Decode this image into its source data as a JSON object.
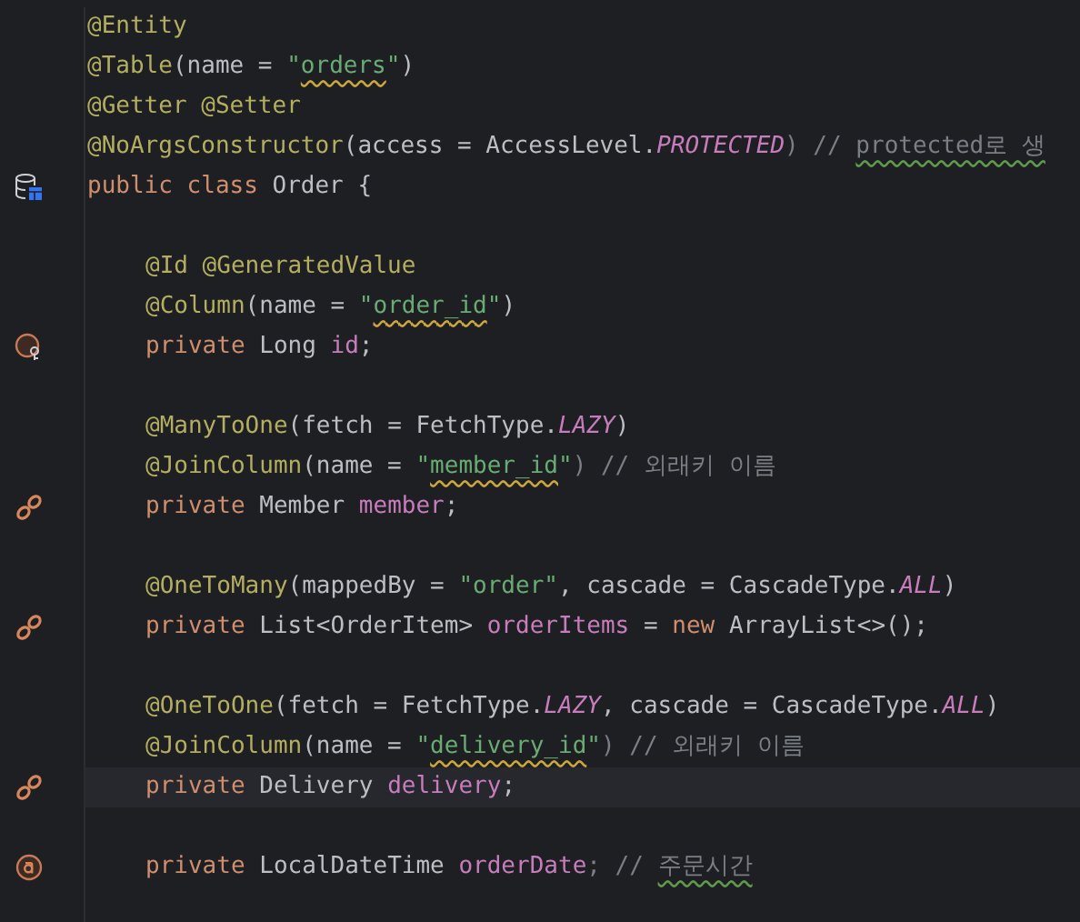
{
  "editor": {
    "lines": [
      {
        "indented": false,
        "current": false,
        "tokens": [
          {
            "text": "@Entity",
            "kind": "annotation"
          }
        ]
      },
      {
        "indented": false,
        "current": false,
        "tokens": [
          {
            "text": "@Table",
            "kind": "annotation"
          },
          {
            "text": "(name = ",
            "kind": "plain"
          },
          {
            "text": "\"",
            "kind": "string"
          },
          {
            "text": "orders",
            "kind": "string",
            "misspelled": true
          },
          {
            "text": "\"",
            "kind": "string"
          },
          {
            "text": ")",
            "kind": "plain"
          }
        ]
      },
      {
        "indented": false,
        "current": false,
        "tokens": [
          {
            "text": "@Getter @Setter",
            "kind": "annotation"
          }
        ]
      },
      {
        "indented": false,
        "current": false,
        "tokens": [
          {
            "text": "@NoArgsConstructor",
            "kind": "annotation"
          },
          {
            "text": "(access = AccessLevel.",
            "kind": "plain"
          },
          {
            "text": "PROTECTED",
            "kind": "constant"
          },
          {
            "text": ") // ",
            "kind": "comment"
          },
          {
            "text": "protected로 생",
            "kind": "comment",
            "grammar_warning": true
          }
        ]
      },
      {
        "indented": false,
        "current": false,
        "gutter": {
          "kind": "entity"
        },
        "tokens": [
          {
            "text": "public class ",
            "kind": "keyword"
          },
          {
            "text": "Order {",
            "kind": "plain"
          }
        ]
      },
      {
        "current": false
      },
      {
        "indented": true,
        "current": false,
        "tokens": [
          {
            "text": "@Id @GeneratedValue",
            "kind": "annotation"
          }
        ]
      },
      {
        "indented": true,
        "current": false,
        "tokens": [
          {
            "text": "@Column",
            "kind": "annotation"
          },
          {
            "text": "(name = ",
            "kind": "plain"
          },
          {
            "text": "\"",
            "kind": "string"
          },
          {
            "text": "order_id",
            "kind": "string",
            "misspelled": true
          },
          {
            "text": "\"",
            "kind": "string"
          },
          {
            "text": ")",
            "kind": "plain"
          }
        ]
      },
      {
        "indented": true,
        "current": false,
        "gutter": {
          "kind": "id"
        },
        "tokens": [
          {
            "text": "private ",
            "kind": "keyword"
          },
          {
            "text": "Long ",
            "kind": "plain"
          },
          {
            "text": "id",
            "kind": "field"
          },
          {
            "text": ";",
            "kind": "plain"
          }
        ]
      },
      {
        "current": false
      },
      {
        "indented": true,
        "current": false,
        "tokens": [
          {
            "text": "@ManyToOne",
            "kind": "annotation"
          },
          {
            "text": "(fetch = FetchType.",
            "kind": "plain"
          },
          {
            "text": "LAZY",
            "kind": "constant"
          },
          {
            "text": ")",
            "kind": "plain"
          }
        ]
      },
      {
        "indented": true,
        "current": false,
        "tokens": [
          {
            "text": "@JoinColumn",
            "kind": "annotation"
          },
          {
            "text": "(name = ",
            "kind": "plain"
          },
          {
            "text": "\"",
            "kind": "string"
          },
          {
            "text": "member_id",
            "kind": "string",
            "misspelled": true
          },
          {
            "text": "\"",
            "kind": "string"
          },
          {
            "text": ") // 외래키 이름",
            "kind": "comment"
          }
        ]
      },
      {
        "indented": true,
        "current": false,
        "gutter": {
          "kind": "relation"
        },
        "tokens": [
          {
            "text": "private ",
            "kind": "keyword"
          },
          {
            "text": "Member ",
            "kind": "plain"
          },
          {
            "text": "member",
            "kind": "field"
          },
          {
            "text": ";",
            "kind": "plain"
          }
        ]
      },
      {
        "current": false
      },
      {
        "indented": true,
        "current": false,
        "tokens": [
          {
            "text": "@OneToMany",
            "kind": "annotation"
          },
          {
            "text": "(mappedBy = ",
            "kind": "plain"
          },
          {
            "text": "\"order\"",
            "kind": "string"
          },
          {
            "text": ", cascade = CascadeType.",
            "kind": "plain"
          },
          {
            "text": "ALL",
            "kind": "constant"
          },
          {
            "text": ")",
            "kind": "plain"
          }
        ]
      },
      {
        "indented": true,
        "current": false,
        "gutter": {
          "kind": "relation"
        },
        "tokens": [
          {
            "text": "private ",
            "kind": "keyword"
          },
          {
            "text": "List<OrderItem> ",
            "kind": "plain"
          },
          {
            "text": "orderItems",
            "kind": "field"
          },
          {
            "text": " = ",
            "kind": "plain"
          },
          {
            "text": "new ",
            "kind": "keyword"
          },
          {
            "text": "ArrayList<>();",
            "kind": "plain"
          }
        ]
      },
      {
        "current": false
      },
      {
        "indented": true,
        "current": false,
        "tokens": [
          {
            "text": "@OneToOne",
            "kind": "annotation"
          },
          {
            "text": "(fetch = FetchType.",
            "kind": "plain"
          },
          {
            "text": "LAZY",
            "kind": "constant"
          },
          {
            "text": ", cascade = CascadeType.",
            "kind": "plain"
          },
          {
            "text": "ALL",
            "kind": "constant"
          },
          {
            "text": ")",
            "kind": "plain"
          }
        ]
      },
      {
        "indented": true,
        "current": false,
        "tokens": [
          {
            "text": "@JoinColumn",
            "kind": "annotation"
          },
          {
            "text": "(name = ",
            "kind": "plain"
          },
          {
            "text": "\"",
            "kind": "string"
          },
          {
            "text": "delivery_id",
            "kind": "string",
            "misspelled": true
          },
          {
            "text": "\"",
            "kind": "string"
          },
          {
            "text": ") // 외래키 이름",
            "kind": "comment"
          }
        ]
      },
      {
        "indented": true,
        "current": true,
        "gutter": {
          "kind": "relation"
        },
        "tokens": [
          {
            "text": "private ",
            "kind": "keyword"
          },
          {
            "text": "Delivery ",
            "kind": "plain"
          },
          {
            "text": "delivery",
            "kind": "field"
          },
          {
            "text": ";",
            "kind": "plain"
          }
        ]
      },
      {
        "current": false
      },
      {
        "indented": true,
        "current": false,
        "gutter": {
          "kind": "field"
        },
        "tokens": [
          {
            "text": "private ",
            "kind": "keyword"
          },
          {
            "text": "LocalDateTime ",
            "kind": "plain"
          },
          {
            "text": "orderDate",
            "kind": "field"
          },
          {
            "text": "; // ",
            "kind": "comment"
          },
          {
            "text": "주문시간",
            "kind": "comment",
            "grammar_warning": true
          }
        ]
      },
      {
        "current": false
      }
    ]
  }
}
